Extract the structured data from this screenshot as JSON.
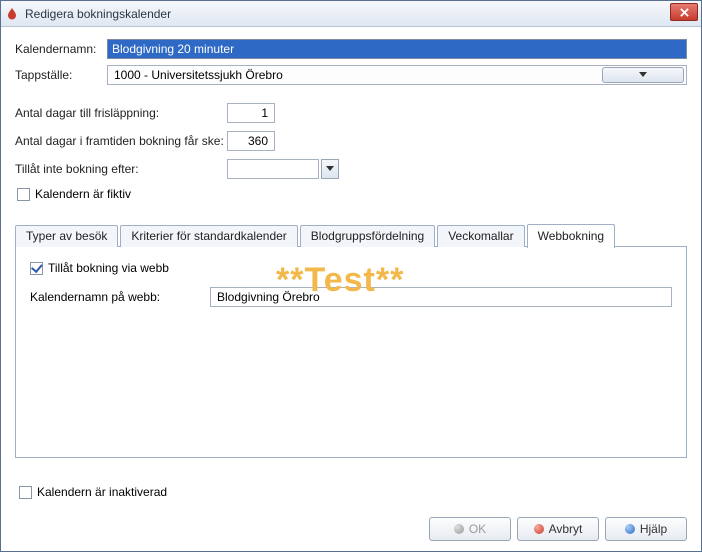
{
  "window": {
    "title": "Redigera bokningskalender"
  },
  "form": {
    "kalendernamn_label": "Kalendernamn:",
    "kalendernamn_value": "Blodgivning 20 minuter",
    "tappstalle_label": "Tappställe:",
    "tappstalle_value": "1000 - Universitetssjukh Örebro",
    "antal_dagar_frislappning_label": "Antal dagar till frisläppning:",
    "antal_dagar_frislappning_value": "1",
    "antal_dagar_framtiden_label": "Antal dagar i framtiden bokning får ske:",
    "antal_dagar_framtiden_value": "360",
    "tillat_inte_efter_label": "Tillåt inte bokning efter:",
    "tillat_inte_efter_value": "",
    "kalendern_fiktiv_label": "Kalendern är fiktiv"
  },
  "tabs": {
    "t0": "Typer av besök",
    "t1": "Kriterier för standardkalender",
    "t2": "Blodgruppsfördelning",
    "t3": "Veckomallar",
    "t4": "Webbokning"
  },
  "webpanel": {
    "tillat_web_label": "Tillåt bokning via webb",
    "kalendernamn_web_label": "Kalendernamn på webb:",
    "kalendernamn_web_value": "Blodgivning Örebro"
  },
  "watermark": "**Test**",
  "footer": {
    "kalendern_inaktiverad_label": "Kalendern är inaktiverad",
    "ok": "OK",
    "avbryt": "Avbryt",
    "hjalp": "Hjälp"
  }
}
